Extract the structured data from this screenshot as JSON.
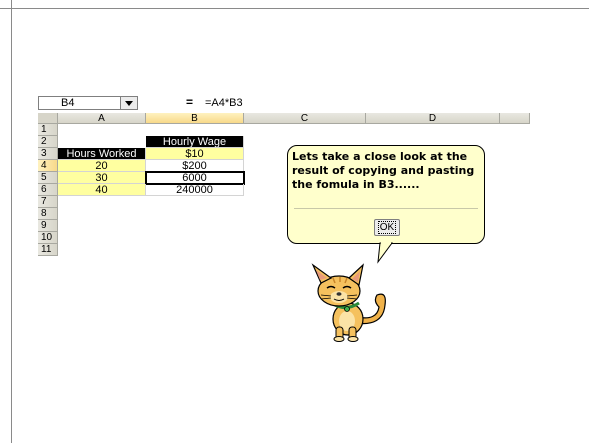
{
  "formula_bar": {
    "name_box": "B4",
    "equals_label": "=",
    "formula": "=A4*B3"
  },
  "columns": [
    "A",
    "B",
    "C",
    "D"
  ],
  "rows": [
    "1",
    "2",
    "3",
    "4",
    "5",
    "6",
    "7",
    "8",
    "9",
    "10",
    "11"
  ],
  "cells": {
    "B1": "Hourly Wage",
    "A2": "Hours Worked",
    "B2": "$10",
    "A3": "20",
    "B3": "$200",
    "A4": "30",
    "B4": "6000",
    "A5": "40",
    "B5": "240000"
  },
  "assistant": {
    "message": "Lets take a close look at the result of copying and pasting the fomula in B3......",
    "ok_label": "OK",
    "icon": "cat-assistant-icon"
  },
  "colors": {
    "header_black": "#000000",
    "highlight_yellow": "#ffffa0",
    "balloon_bg": "#ffffcc"
  }
}
